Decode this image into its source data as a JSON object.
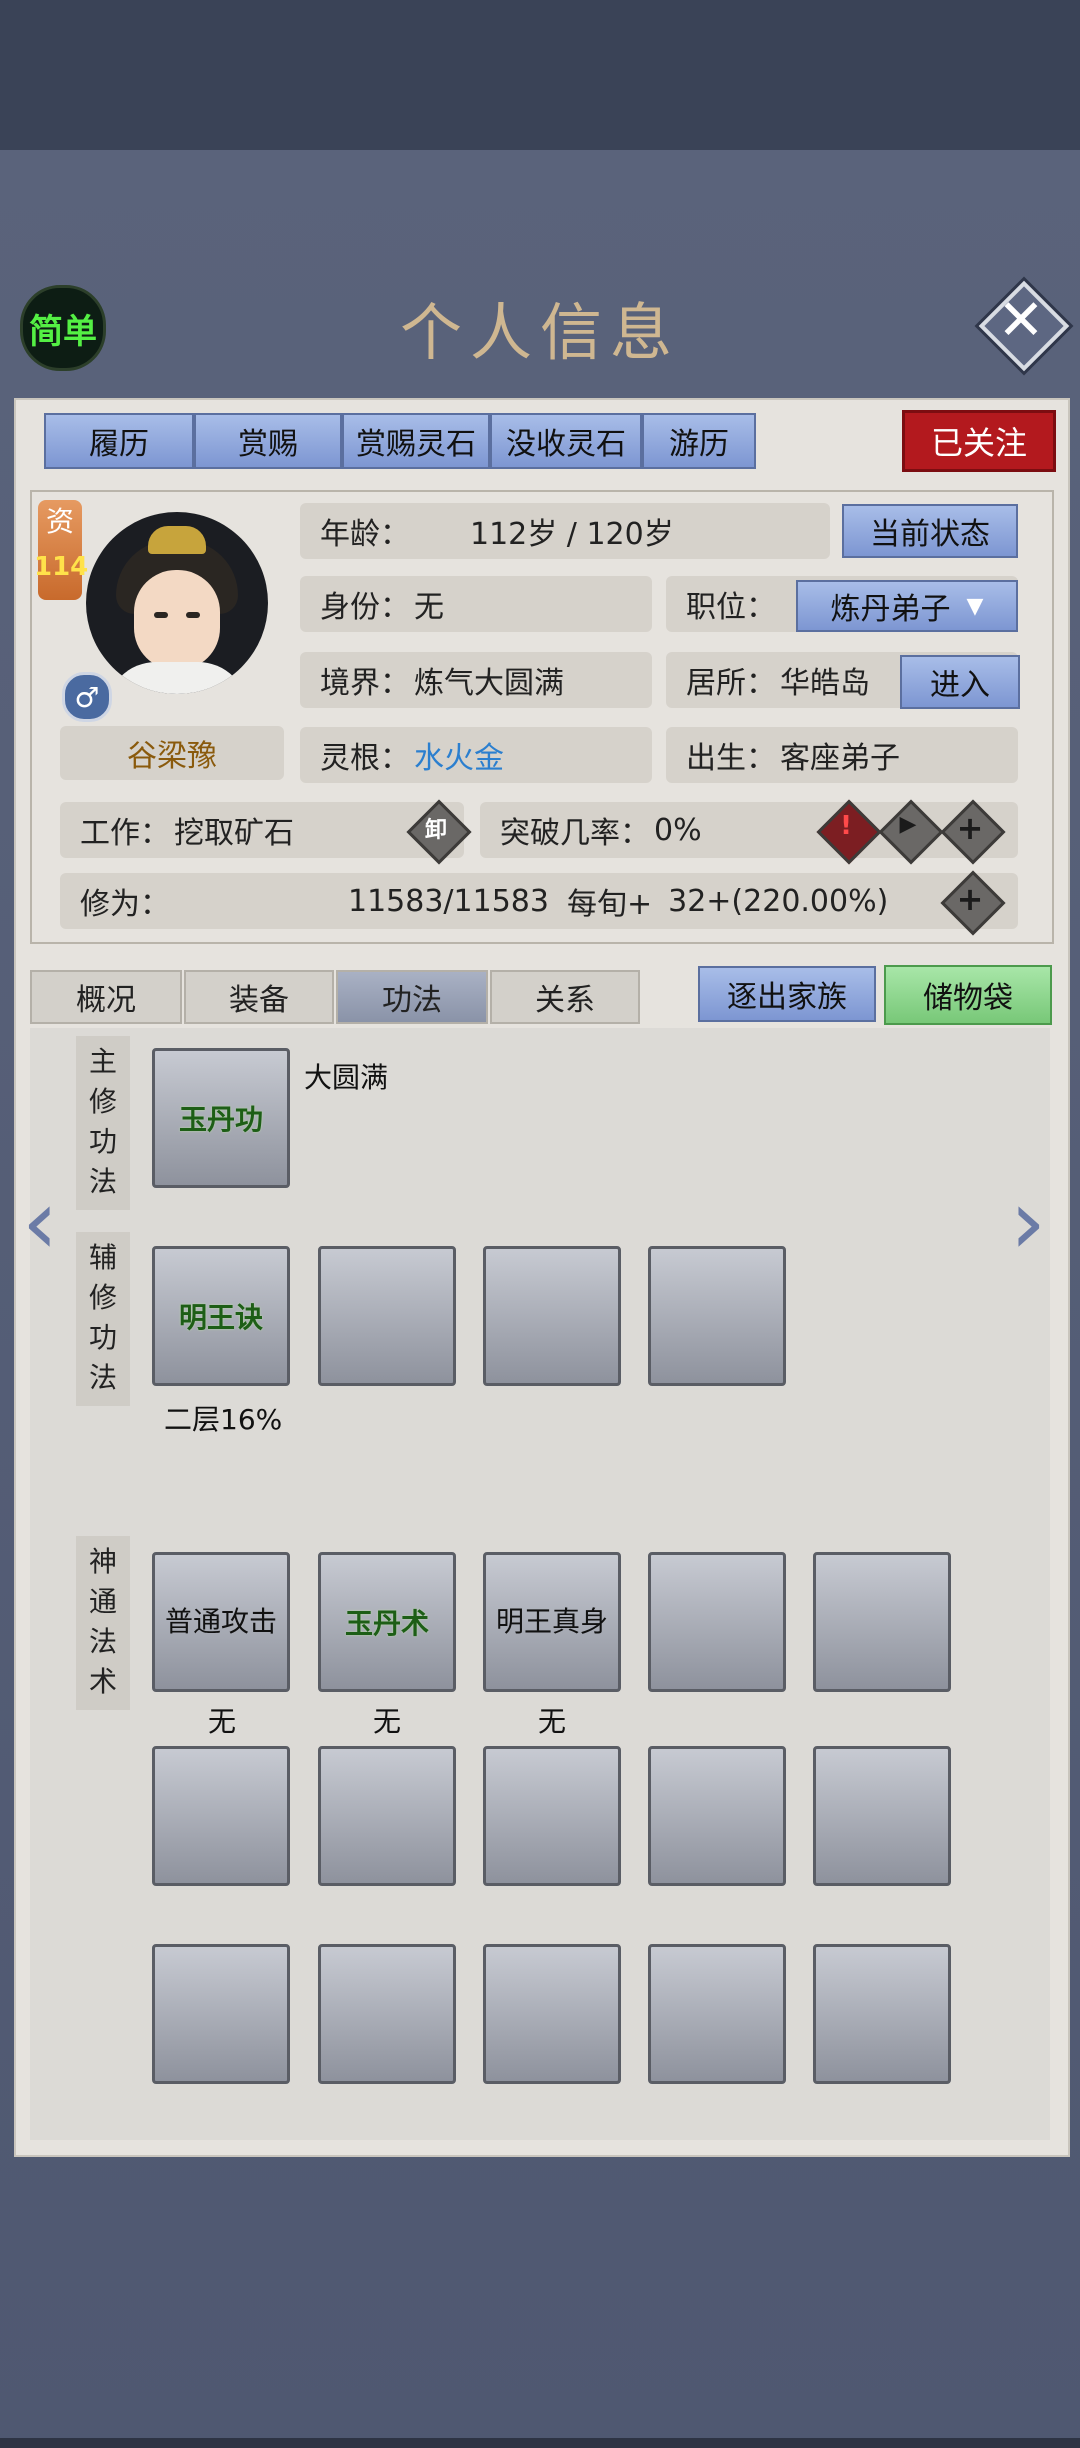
{
  "header": {
    "simple_label": "简单",
    "title": "个人信息",
    "close_glyph": "✕"
  },
  "top_tabs": [
    "履历",
    "赏赐",
    "赏赐灵石",
    "没收灵石",
    "游历"
  ],
  "followed_label": "已关注",
  "character": {
    "aptitude_label": "资",
    "aptitude_value": "114",
    "gender_glyph": "♂",
    "name": "谷梁豫",
    "age_label": "年龄：",
    "age_value": "112岁 / 120岁",
    "status_button": "当前状态",
    "identity_label": "身份：",
    "identity_value": "无",
    "position_label": "职位：",
    "position_value": "炼丹弟子",
    "realm_label": "境界：",
    "realm_value": "炼气大圆满",
    "residence_label": "居所：",
    "residence_value": "华皓岛",
    "enter_button": "进入",
    "root_label": "灵根：",
    "root_value": "水火金",
    "birth_label": "出生：",
    "birth_value": "客座弟子",
    "work_label": "工作：",
    "work_value": "挖取矿石",
    "unequip_glyph": "卸",
    "breakthrough_label": "突破几率：",
    "breakthrough_value": "0%",
    "cultivation_label": "修为：",
    "cultivation_value": "11583/11583",
    "per_round_label": "每旬+",
    "per_round_value": "32+(220.00%)"
  },
  "sub_tabs": [
    "概况",
    "装备",
    "功法",
    "关系"
  ],
  "expel_button": "逐出家族",
  "storage_button": "储物袋",
  "techniques": {
    "main_label": [
      "主",
      "修",
      "功",
      "法"
    ],
    "main_skill": "玉丹功",
    "main_level": "大圆满",
    "aux_label": [
      "辅",
      "修",
      "功",
      "法"
    ],
    "aux_skill": "明王诀",
    "aux_level": "二层16%",
    "spell_label": [
      "神",
      "通",
      "法",
      "术"
    ],
    "spells": [
      {
        "name": "普通攻击",
        "caption": "无"
      },
      {
        "name": "玉丹术",
        "caption": "无"
      },
      {
        "name": "明王真身",
        "caption": "无"
      }
    ]
  },
  "colors": {
    "panel_bg": "#e6e3de",
    "tab_blue": "#8ea6dc",
    "followed_red": "#b3191e",
    "skill_green": "#1d5e16",
    "root_blue": "#2b7fcf"
  }
}
